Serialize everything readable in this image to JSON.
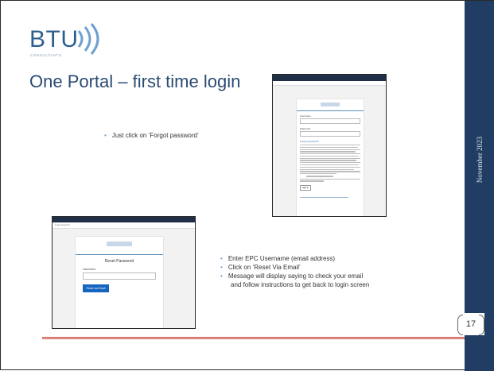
{
  "slide": {
    "logo_text": "BTU",
    "logo_sub": "CONSULTANTS",
    "title": "One Portal – first time login",
    "date": "November 2023",
    "page_number": "17"
  },
  "bullets": {
    "top": "Just click on ‘Forgot password’",
    "bottom": [
      "Enter EPC Username (email address)",
      "Click on ‘Reset Via Email’",
      "Message will display saying to check your email",
      "and follow instructions to get back to login screen"
    ]
  },
  "login_screenshot": {
    "username_label": "Username",
    "password_label": "Password",
    "forgot_link": "Forgot password?",
    "signin_label": "Sign In"
  },
  "reset_screenshot": {
    "heading": "Reset Password",
    "username_label": "Username",
    "button_label": "Reset via Email",
    "subbar_text": "Forgot password"
  },
  "colors": {
    "sidebar": "#213d63",
    "title": "#2b4b73",
    "accent_line": "#c0392b",
    "button": "#1565c0"
  }
}
